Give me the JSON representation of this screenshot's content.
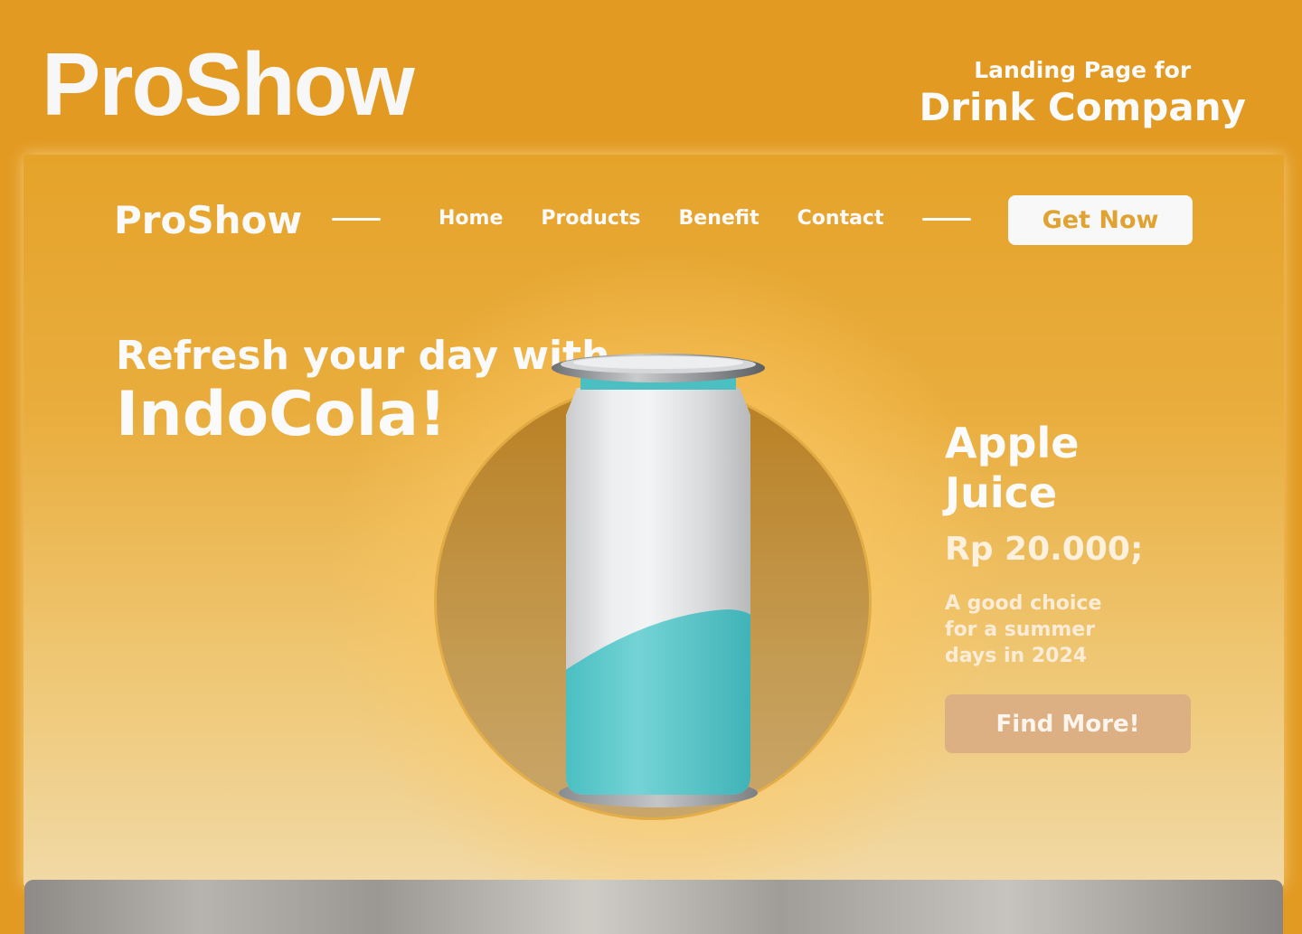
{
  "header": {
    "title": "ProShow",
    "subtitle_line1": "Landing Page for",
    "subtitle_line2": "Drink Company"
  },
  "nav": {
    "logo": "ProShow",
    "links": [
      "Home",
      "Products",
      "Benefit",
      "Contact"
    ],
    "cta_label": "Get Now"
  },
  "hero": {
    "headline_line1": "Refresh your day with",
    "headline_line2": "IndoCola!"
  },
  "product": {
    "name": "Apple Juice",
    "price": "Rp 20.000;",
    "description": "A good choice for a summer days in 2024",
    "button_label": "Find More!"
  },
  "colors": {
    "background": "#e29a22",
    "accent_text": "#e0a232",
    "can_teal": "#55c8cb",
    "find_button": "#ddb084"
  }
}
